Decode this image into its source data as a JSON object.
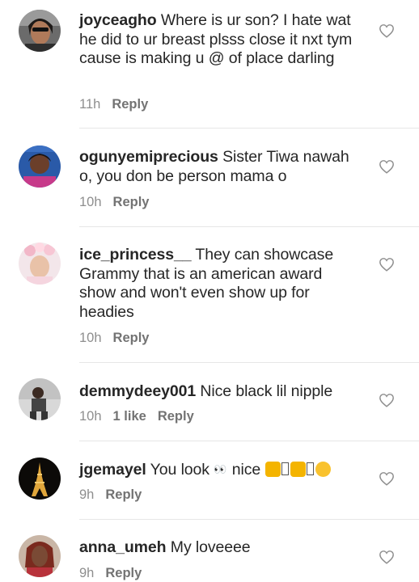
{
  "comments": [
    {
      "username": "joyceagho",
      "text": "Where is ur son? I hate wat he did to ur breast plsss close it nxt tym cause is making u @ of place darling",
      "time": "11h",
      "likes": "",
      "reply_label": "Reply",
      "avatar_icon": "profile-photo"
    },
    {
      "username": "ogunyemiprecious",
      "text": "Sister Tiwa nawah o, you don be person mama o",
      "time": "10h",
      "likes": "",
      "reply_label": "Reply",
      "avatar_icon": "profile-photo"
    },
    {
      "username": "ice_princess__",
      "text": "They can showcase Grammy that is an american award show and won't even show up for headies",
      "time": "10h",
      "likes": "",
      "reply_label": "Reply",
      "avatar_icon": "profile-photo"
    },
    {
      "username": "demmydeey001",
      "text": "Nice black lil nipple",
      "time": "10h",
      "likes": "1 like",
      "reply_label": "Reply",
      "avatar_icon": "profile-photo"
    },
    {
      "username": "jgemayel",
      "text_before": "You look",
      "text_middle": "nice",
      "time": "9h",
      "likes": "",
      "reply_label": "Reply",
      "avatar_icon": "eiffel-tower-photo"
    },
    {
      "username": "anna_umeh",
      "text": "My loveeee",
      "time": "9h",
      "likes": "",
      "reply_label": "Reply",
      "avatar_icon": "profile-photo"
    }
  ],
  "icons": {
    "like": "heart-outline-icon"
  },
  "colors": {
    "username": "#262626",
    "meta": "#8e8e8e",
    "divider": "#e6e6e6"
  }
}
